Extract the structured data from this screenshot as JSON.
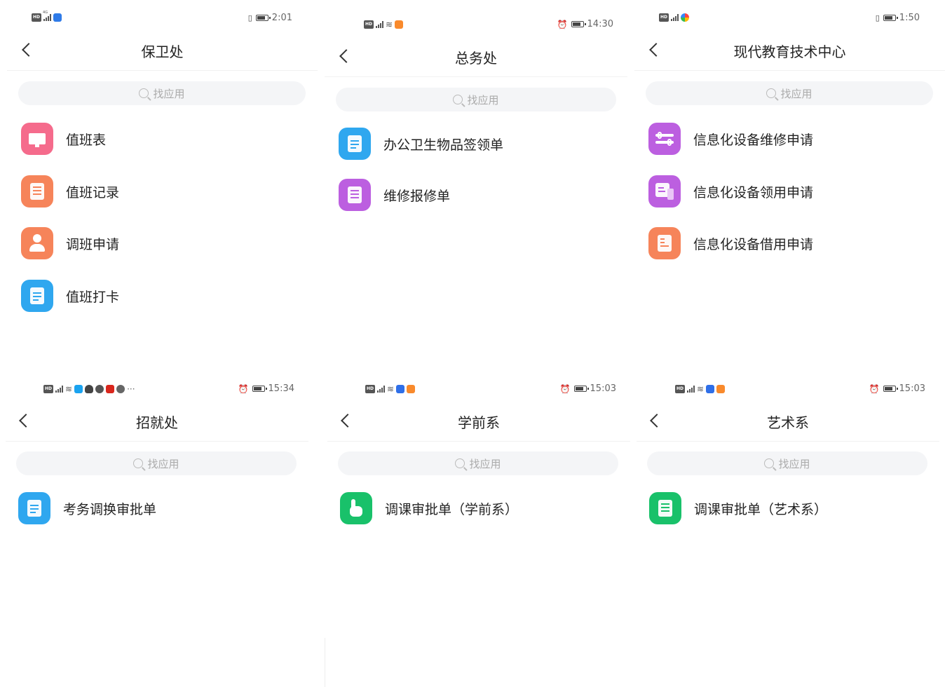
{
  "panels": [
    {
      "status": {
        "time": "2:01"
      },
      "title": "保卫处",
      "search_placeholder": "找应用",
      "items": [
        {
          "label": "值班表",
          "icon": "monitor-icon",
          "color": "#f56b8c"
        },
        {
          "label": "值班记录",
          "icon": "notebook-icon",
          "color": "#f6845a"
        },
        {
          "label": "调班申请",
          "icon": "person-icon",
          "color": "#f6845a"
        },
        {
          "label": "值班打卡",
          "icon": "clipboard-icon",
          "color": "#2fa7ef"
        }
      ]
    },
    {
      "status": {
        "time": "14:30"
      },
      "title": "总务处",
      "search_placeholder": "找应用",
      "items": [
        {
          "label": "办公卫生物品签领单",
          "icon": "clipboard-icon",
          "color": "#2fa7ef"
        },
        {
          "label": "维修报修单",
          "icon": "notebook-icon",
          "color": "#bc5fe0"
        }
      ]
    },
    {
      "status": {
        "time": "1:50"
      },
      "title": "现代教育技术中心",
      "search_placeholder": "找应用",
      "items": [
        {
          "label": "信息化设备维修申请",
          "icon": "wrench-icon",
          "color": "#bc5fe0"
        },
        {
          "label": "信息化设备领用申请",
          "icon": "device-icon",
          "color": "#bc5fe0"
        },
        {
          "label": "信息化设备借用申请",
          "icon": "document-icon",
          "color": "#f6845a"
        }
      ]
    },
    {
      "status": {
        "time": "15:34"
      },
      "title": "招就处",
      "search_placeholder": "找应用",
      "items": [
        {
          "label": "考务调换审批单",
          "icon": "clipboard-icon",
          "color": "#2fa7ef"
        }
      ]
    },
    {
      "status": {
        "time": "15:03"
      },
      "title": "学前系",
      "search_placeholder": "找应用",
      "items": [
        {
          "label": "调课审批单（学前系）",
          "icon": "hand-pointer-icon",
          "color": "#19c16a"
        }
      ]
    },
    {
      "status": {
        "time": "15:03"
      },
      "title": "艺术系",
      "search_placeholder": "找应用",
      "items": [
        {
          "label": "调课审批单（艺术系）",
          "icon": "notebook-icon",
          "color": "#19c16a"
        }
      ]
    }
  ]
}
